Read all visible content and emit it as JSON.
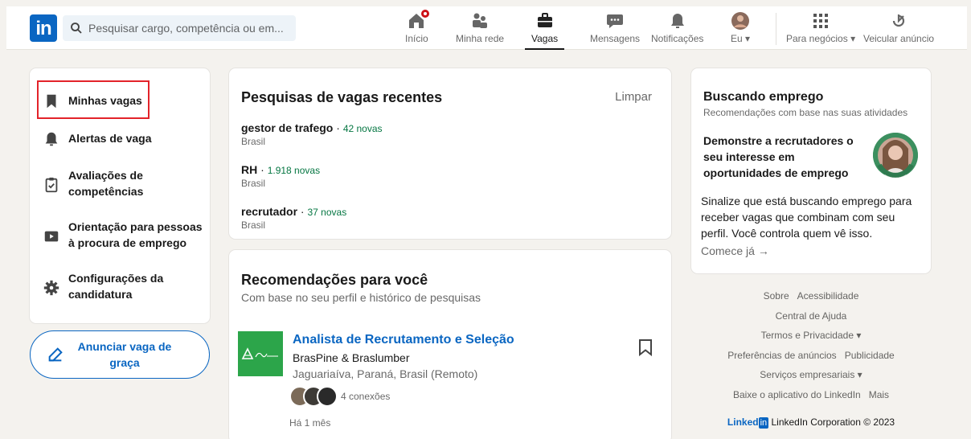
{
  "search": {
    "placeholder": "Pesquisar cargo, competência ou em..."
  },
  "nav": {
    "home": "Início",
    "network": "Minha rede",
    "jobs": "Vagas",
    "messages": "Mensagens",
    "notifications": "Notificações",
    "me": "Eu",
    "business": "Para negócios",
    "advertise": "Veicular anúncio"
  },
  "sidebar": {
    "items": [
      {
        "label": "Minhas vagas",
        "icon": "bookmark-icon"
      },
      {
        "label": "Alertas de vaga",
        "icon": "bell-icon"
      },
      {
        "label": "Avaliações de competências",
        "icon": "clipboard-check-icon"
      },
      {
        "label": "Orientação para pessoas à procura de emprego",
        "icon": "video-play-icon"
      },
      {
        "label": "Configurações da candidatura",
        "icon": "gear-icon"
      }
    ],
    "post_job": "Anunciar vaga de graça"
  },
  "recent_searches": {
    "title": "Pesquisas de vagas recentes",
    "clear": "Limpar",
    "items": [
      {
        "query": "gestor de trafego",
        "new": "42 novas",
        "location": "Brasil"
      },
      {
        "query": "RH",
        "new": "1.918 novas",
        "location": "Brasil"
      },
      {
        "query": "recrutador",
        "new": "37 novas",
        "location": "Brasil"
      }
    ]
  },
  "recommendations": {
    "title": "Recomendações para você",
    "subtitle": "Com base no seu perfil e histórico de pesquisas",
    "job": {
      "title": "Analista de Recrutamento e Seleção",
      "company": "BrasPine & Braslumber",
      "location": "Jaguariaíva, Paraná, Brasil (Remoto)",
      "connections": "4 conexões",
      "posted": "Há 1 mês"
    }
  },
  "job_seeking": {
    "title": "Buscando emprego",
    "subtitle": "Recomendações com base nas suas atividades",
    "heading": "Demonstre a recrutadores o seu interesse em oportunidades de emprego",
    "body": "Sinalize que está buscando emprego para receber vagas que combinam com seu perfil. Você controla quem vê isso.",
    "cta": "Comece já"
  },
  "footer": {
    "links_row1": [
      "Sobre",
      "Acessibilidade"
    ],
    "links_row2": [
      "Central de Ajuda"
    ],
    "links_row3": [
      "Termos e Privacidade"
    ],
    "links_row4": [
      "Preferências de anúncios",
      "Publicidade"
    ],
    "links_row5": [
      "Serviços empresariais"
    ],
    "links_row6": [
      "Baixe o aplicativo do LinkedIn",
      "Mais"
    ],
    "brand": "Linked",
    "brand_in": "in",
    "copyright": "LinkedIn Corporation © 2023"
  },
  "colors": {
    "brand": "#0a66c2",
    "new_count": "#057642",
    "highlight": "#e3232a",
    "badge": "#cc1016"
  }
}
